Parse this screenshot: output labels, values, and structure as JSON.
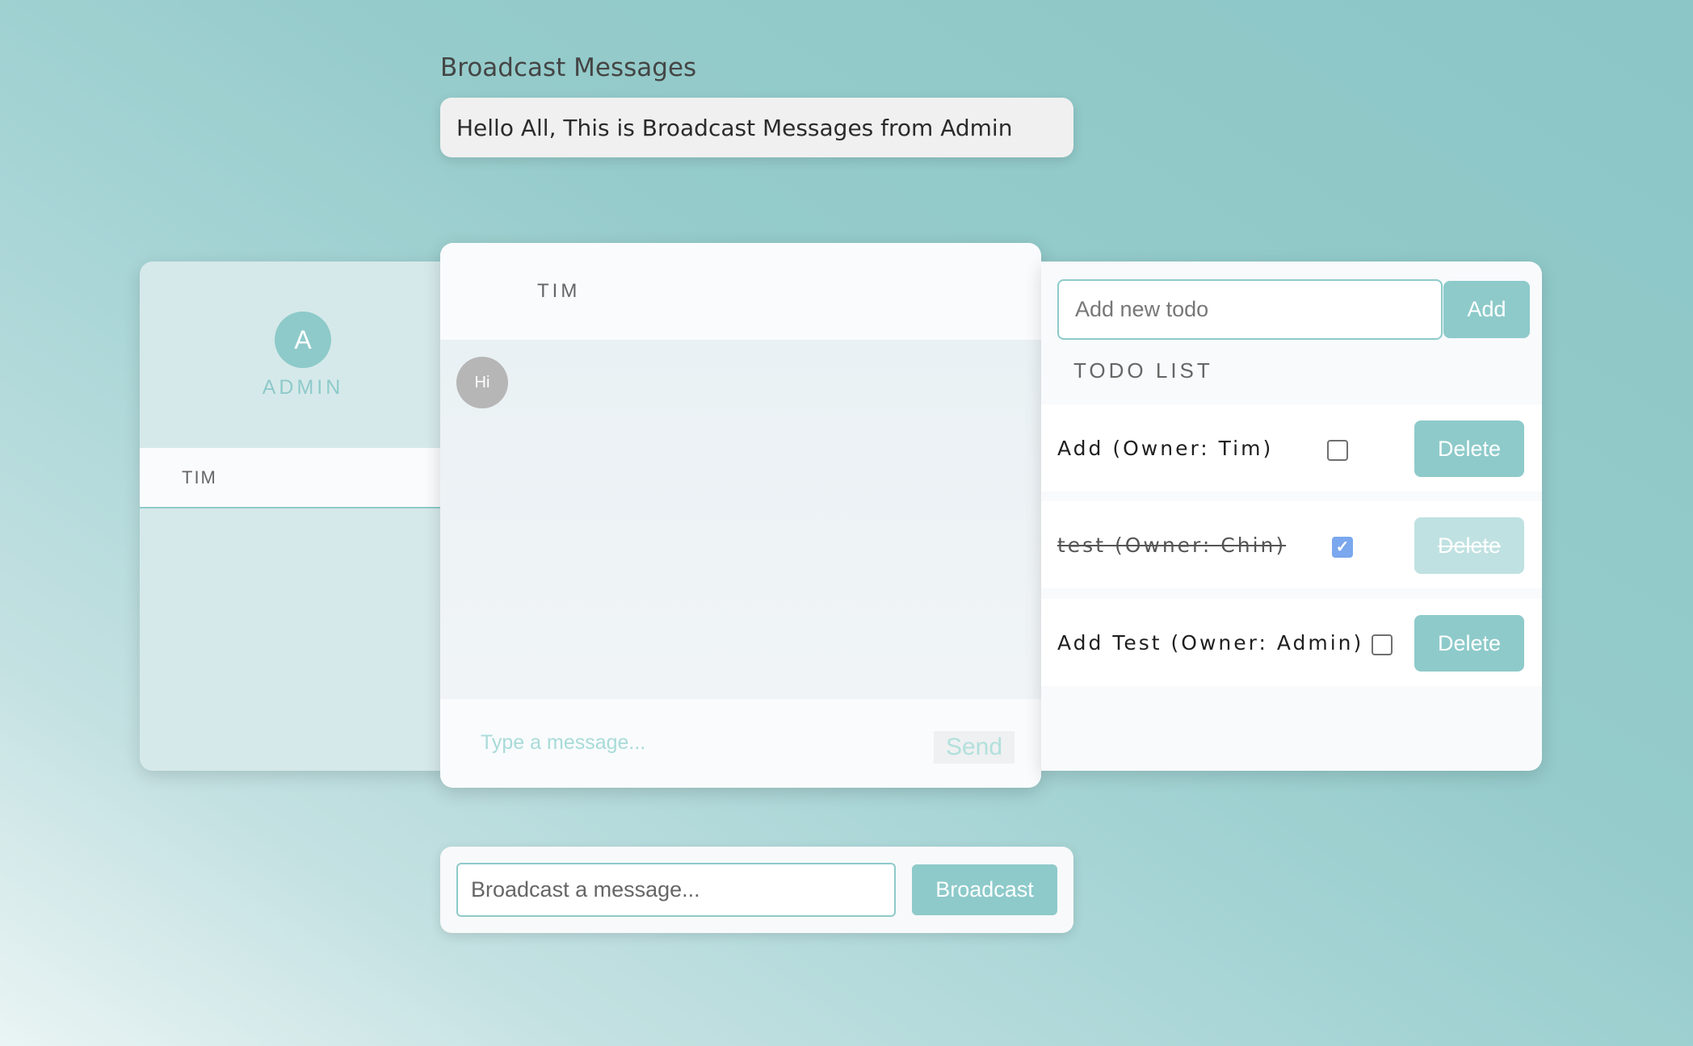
{
  "broadcast": {
    "title": "Broadcast Messages",
    "message": "Hello All, This is Broadcast Messages from Admin",
    "input_placeholder": "Broadcast a message...",
    "button_label": "Broadcast"
  },
  "sidebar": {
    "avatar_letter": "A",
    "username": "ADMIN",
    "users": [
      {
        "name": "TIM"
      }
    ]
  },
  "chat": {
    "header": "TIM",
    "messages": [
      {
        "text": "Hi"
      }
    ],
    "input_placeholder": "Type a message...",
    "send_label": "Send"
  },
  "todo": {
    "input_placeholder": "Add new todo",
    "add_label": "Add",
    "title": "TODO LIST",
    "items": [
      {
        "text": "Add (Owner: Tim)",
        "done": false,
        "delete_label": "Delete"
      },
      {
        "text": "test (Owner: Chin)",
        "done": true,
        "delete_label": "Delete"
      },
      {
        "text": "Add Test (Owner: Admin)",
        "done": false,
        "delete_label": "Delete"
      }
    ]
  },
  "colors": {
    "accent": "#8ecaca",
    "checkbox_checked": "#7aa7ee"
  }
}
